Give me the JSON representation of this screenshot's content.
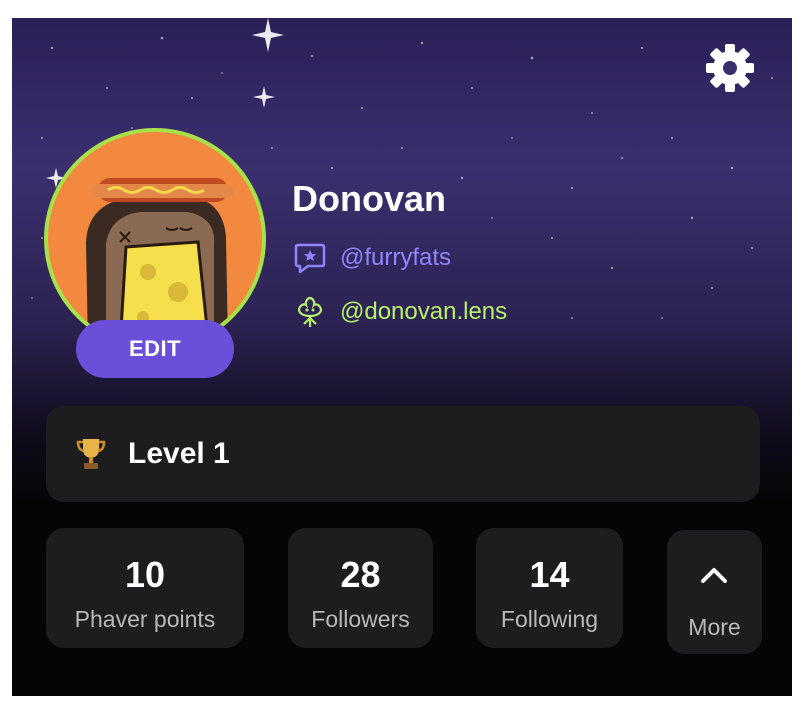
{
  "profile": {
    "name": "Donovan",
    "handle_phaver": "@furryfats",
    "handle_lens": "@donovan.lens",
    "edit_label": "EDIT"
  },
  "level": {
    "label": "Level 1",
    "icon": "trophy-icon"
  },
  "stats": [
    {
      "value": "10",
      "label": "Phaver points"
    },
    {
      "value": "28",
      "label": "Followers"
    },
    {
      "value": "14",
      "label": "Following"
    }
  ],
  "more": {
    "label": "More",
    "icon": "chevron-up-icon"
  },
  "icons": {
    "settings": "gear-icon",
    "phaver": "phaver-star-bubble-icon",
    "lens": "lens-flower-icon"
  },
  "colors": {
    "accent_purple": "#6b4fd8",
    "phaver_handle": "#8f86ff",
    "lens_handle": "#b7f06a",
    "avatar_ring": "#a6e14a",
    "avatar_bg": "#f3893e",
    "card_bg": "#1d1d1f"
  }
}
